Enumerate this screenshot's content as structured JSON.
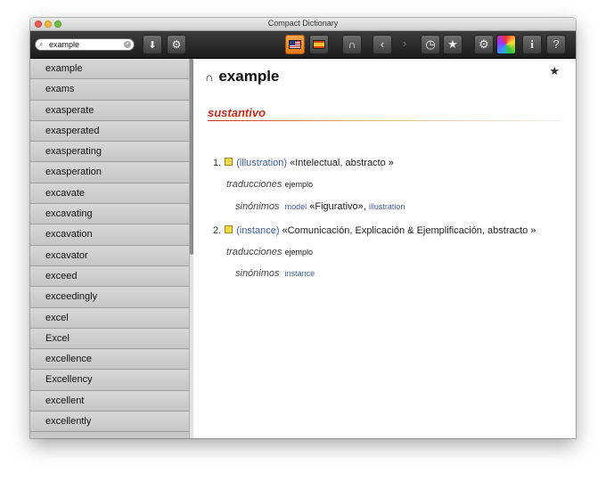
{
  "window": {
    "title": "Compact Dictionary"
  },
  "search": {
    "value": "example",
    "icon": "magnifier-icon"
  },
  "toolbar": {
    "languages": [
      {
        "name": "english-flag",
        "active": true
      },
      {
        "name": "spanish-flag",
        "active": false
      }
    ],
    "icons": [
      "headphones-icon",
      "back-arrow-icon",
      "forward-arrow-icon",
      "history-icon",
      "star-icon",
      "gear-icon",
      "color-wheel-icon",
      "info-icon",
      "help-icon"
    ],
    "glyphs": {
      "headphones": "🎧",
      "back": "‹",
      "forward": "›",
      "history": "◷",
      "star": "★",
      "gear": "⚙",
      "info": "i",
      "help": "?",
      "clear": "×",
      "mag": "⌕",
      "download": "⬇",
      "settings": "⚙"
    }
  },
  "sidebar": {
    "words": [
      "example",
      "exams",
      "exasperate",
      "exasperated",
      "exasperating",
      "exasperation",
      "excavate",
      "excavating",
      "excavation",
      "excavator",
      "exceed",
      "exceedingly",
      "excel",
      "Excel",
      "excellence",
      "Excellency",
      "excellent",
      "excellently"
    ]
  },
  "entry": {
    "headword": "example",
    "pronounce_icon": "∩",
    "favorite_icon": "★",
    "part_of_speech": "sustantivo",
    "senses": [
      {
        "number": "1.",
        "gloss": "(illustration)",
        "domain": "«Intelectual, abstracto »",
        "translations_label": "traducciones",
        "translations": "ejemplo",
        "synonyms_label": "sinónimos",
        "synonym1": "model",
        "synonym1_domain": "«Figurativo»,",
        "synonym2": "illustration"
      },
      {
        "number": "2.",
        "gloss": "(instance)",
        "domain": "«Comunicación, Explicación & Ejemplificación, abstracto »",
        "translations_label": "traducciones",
        "translations": "ejemplo",
        "synonyms_label": "sinónimos",
        "synonym1": "instance"
      }
    ]
  },
  "colors": {
    "accent": "#c62a1e",
    "link": "#3d5c97",
    "toolbar_active": "#f08c2a"
  }
}
